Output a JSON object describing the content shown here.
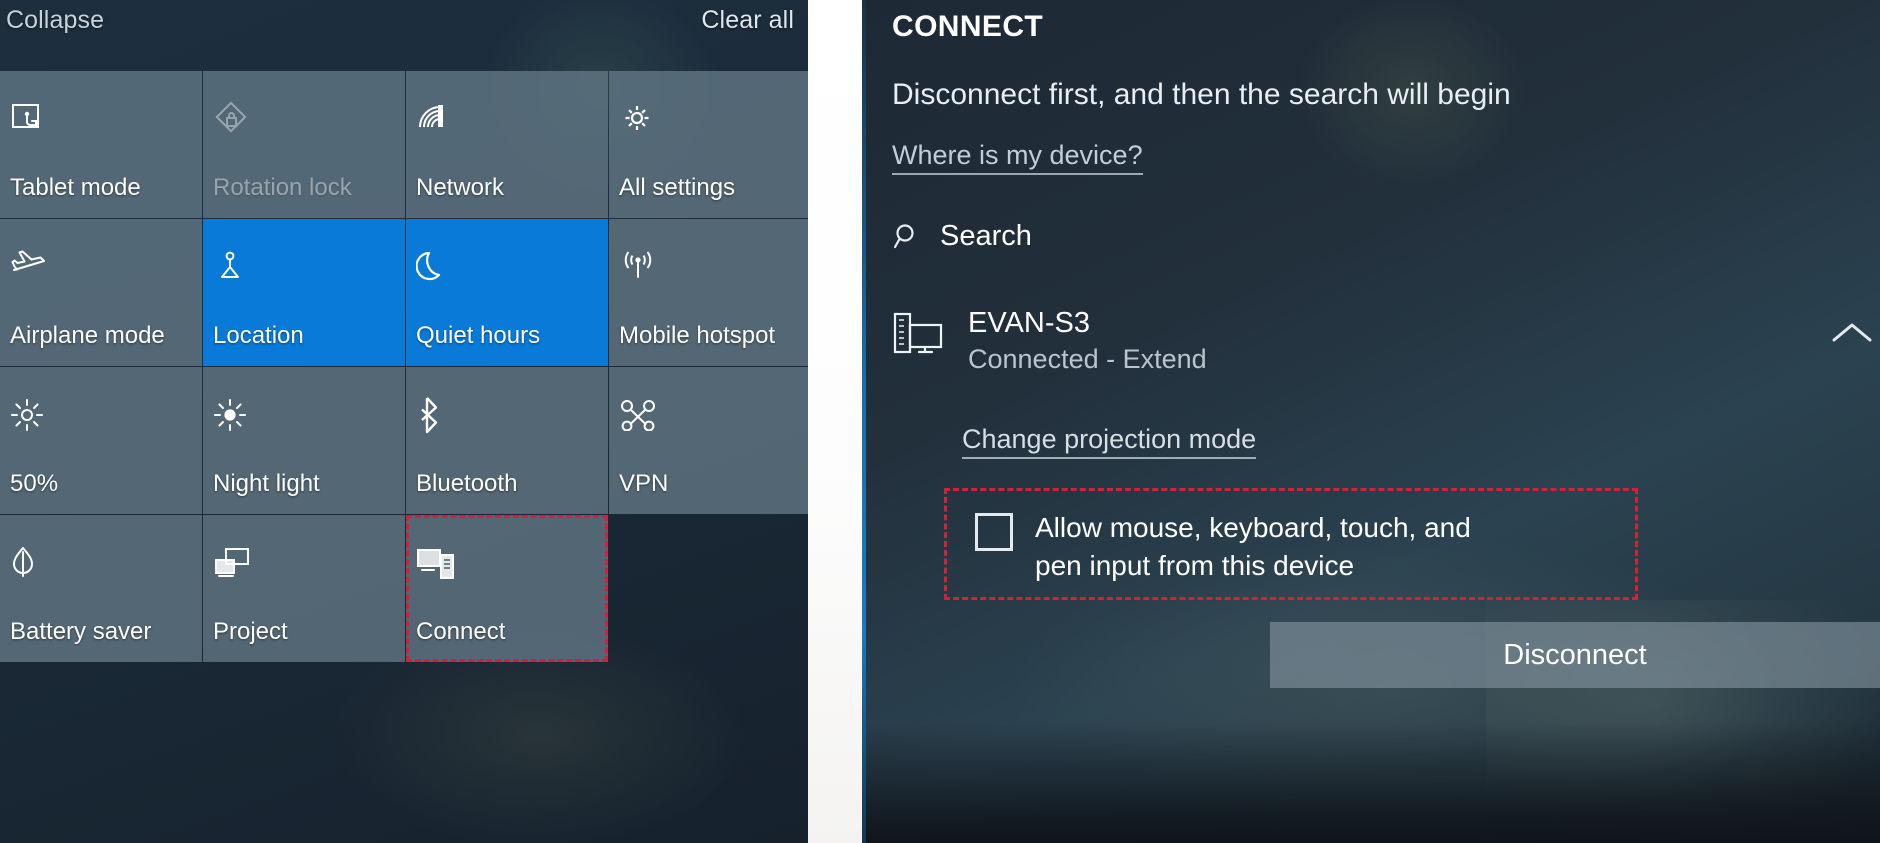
{
  "action_center": {
    "collapse_label": "Collapse",
    "clear_all_label": "Clear all",
    "tiles": [
      {
        "label": "Tablet mode",
        "icon": "tablet-mode-icon",
        "state": "off"
      },
      {
        "label": "Rotation lock",
        "icon": "rotation-lock-icon",
        "state": "disabled"
      },
      {
        "label": "Network",
        "icon": "network-wifi-icon",
        "state": "off"
      },
      {
        "label": "All settings",
        "icon": "gear-icon",
        "state": "off"
      },
      {
        "label": "Airplane mode",
        "icon": "airplane-icon",
        "state": "off"
      },
      {
        "label": "Location",
        "icon": "location-icon",
        "state": "on"
      },
      {
        "label": "Quiet hours",
        "icon": "moon-icon",
        "state": "on"
      },
      {
        "label": "Mobile hotspot",
        "icon": "hotspot-icon",
        "state": "off"
      },
      {
        "label": "50%",
        "icon": "brightness-icon",
        "state": "off"
      },
      {
        "label": "Night light",
        "icon": "night-light-icon",
        "state": "off"
      },
      {
        "label": "Bluetooth",
        "icon": "bluetooth-icon",
        "state": "off"
      },
      {
        "label": "VPN",
        "icon": "vpn-icon",
        "state": "off"
      },
      {
        "label": "Battery saver",
        "icon": "battery-leaf-icon",
        "state": "off"
      },
      {
        "label": "Project",
        "icon": "project-icon",
        "state": "off"
      },
      {
        "label": "Connect",
        "icon": "connect-icon",
        "state": "off",
        "annotated": true
      }
    ]
  },
  "connect_panel": {
    "title": "CONNECT",
    "status_message": "Disconnect first, and then the search will begin",
    "where_is_my_device": "Where is my device?",
    "search_label": "Search",
    "search_icon": "search-icon",
    "collapse_chevron_icon": "chevron-up-icon",
    "device": {
      "name": "EVAN-S3",
      "state": "Connected - Extend",
      "icon": "display-device-icon"
    },
    "change_projection_mode": "Change projection mode",
    "allow_input": {
      "label_line1": "Allow mouse, keyboard, touch, and",
      "label_line2": "pen input from this device",
      "checked": false
    },
    "disconnect_label": "Disconnect"
  },
  "annotation": {
    "color": "#cf2338",
    "style": "dashed"
  },
  "colors": {
    "accent_active_tile": "#0a7ad8",
    "tile_background": "#617785",
    "panel_background": "#22303c",
    "action_center_background": "#1b2b3a",
    "text_primary": "#ffffff",
    "text_secondary": "#b9c5cd"
  }
}
